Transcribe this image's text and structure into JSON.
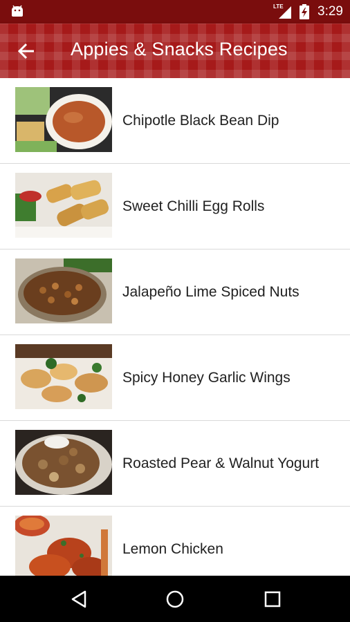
{
  "status_bar": {
    "network": "LTE",
    "time": "3:29"
  },
  "app_bar": {
    "title": "Appies & Snacks Recipes"
  },
  "recipes": [
    {
      "name": "Chipotle Black Bean Dip"
    },
    {
      "name": "Sweet Chilli Egg Rolls"
    },
    {
      "name": "Jalapeño Lime Spiced Nuts"
    },
    {
      "name": "Spicy Honey Garlic Wings"
    },
    {
      "name": "Roasted Pear & Walnut Yogurt"
    },
    {
      "name": "Lemon Chicken"
    }
  ],
  "colors": {
    "status_bar": "#7a0d0d",
    "app_bar": "#a61a1a",
    "text": "#212121",
    "divider": "#d9d9d9",
    "nav_bar": "#000000"
  },
  "icons": {
    "status_left": "android-icon",
    "signal": "signal-icon",
    "battery": "battery-charging-icon",
    "back": "arrow-left-icon",
    "nav": [
      "back-triangle-icon",
      "home-circle-icon",
      "recents-square-icon"
    ]
  }
}
